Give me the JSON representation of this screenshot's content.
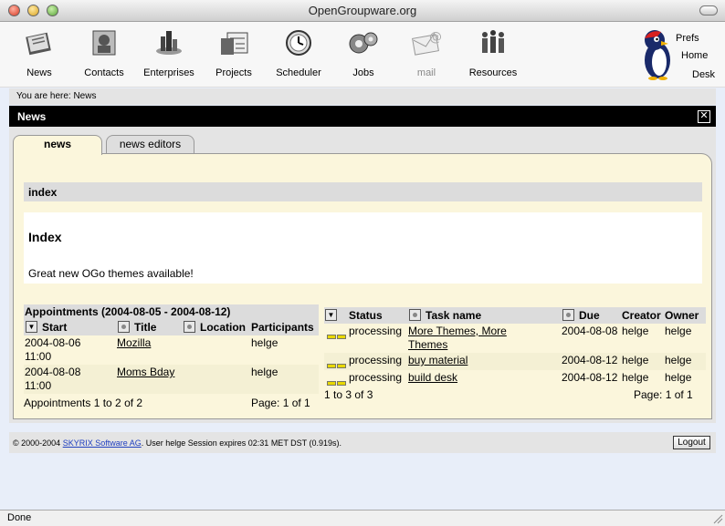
{
  "window": {
    "title": "OpenGroupware.org"
  },
  "nav": {
    "items": [
      {
        "label": "News",
        "icon": "news-icon"
      },
      {
        "label": "Contacts",
        "icon": "contacts-icon"
      },
      {
        "label": "Enterprises",
        "icon": "enterprises-icon"
      },
      {
        "label": "Projects",
        "icon": "projects-icon"
      },
      {
        "label": "Scheduler",
        "icon": "scheduler-icon"
      },
      {
        "label": "Jobs",
        "icon": "jobs-icon"
      },
      {
        "label": "mail",
        "icon": "mail-icon"
      },
      {
        "label": "Resources",
        "icon": "resources-icon"
      }
    ],
    "quick_links": {
      "prefs": "Prefs",
      "home": "Home",
      "desk": "Desk"
    }
  },
  "breadcrumb": "You are here: News",
  "panel": {
    "title": "News",
    "close_symbol": "✕",
    "tabs": [
      {
        "label": "news",
        "active": true
      },
      {
        "label": "news editors",
        "active": false
      }
    ]
  },
  "index": {
    "bar_label": "index",
    "heading": "Index",
    "text": "Great new OGo themes available!"
  },
  "appointments": {
    "title": "Appointments (2004-08-05 - 2004-08-12)",
    "columns": {
      "start": "Start",
      "title": "Title",
      "location": "Location",
      "participants": "Participants"
    },
    "rows": [
      {
        "date": "2004-08-06",
        "time": "11:00",
        "title": "Mozilla",
        "location": "",
        "participants": "helge"
      },
      {
        "date": "2004-08-08",
        "time": "11:00",
        "title": "Moms Bday",
        "location": "",
        "participants": "helge"
      }
    ],
    "summary": "Appointments 1 to 2 of 2",
    "page": "Page: 1 of 1"
  },
  "tasks": {
    "columns": {
      "status": "Status",
      "name": "Task name",
      "due": "Due",
      "creator": "Creator",
      "owner": "Owner"
    },
    "rows": [
      {
        "status": "processing",
        "name_line1": "More Themes, More",
        "name_line2": "Themes",
        "due": "2004-08-08",
        "creator": "helge",
        "owner": "helge"
      },
      {
        "status": "processing",
        "name_line1": "buy material",
        "name_line2": "",
        "due": "2004-08-12",
        "creator": "helge",
        "owner": "helge"
      },
      {
        "status": "processing",
        "name_line1": "build desk",
        "name_line2": "",
        "due": "2004-08-12",
        "creator": "helge",
        "owner": "helge"
      }
    ],
    "summary": "1 to 3 of 3",
    "page": "Page: 1 of 1"
  },
  "footer": {
    "copyright": "© 2000-2004",
    "company_link": "SKYRIX Software AG",
    "session_text": ". User helge Session expires 02:31 MET DST (0.919s).",
    "logout_label": "Logout"
  },
  "statusbar": {
    "text": "Done"
  },
  "colors": {
    "header_bg": "#000000",
    "content_bg": "#fbf6dc",
    "panel_bg": "#e4e4e4",
    "status_yellow": "#e8d800",
    "link_blue": "#2040c0"
  }
}
